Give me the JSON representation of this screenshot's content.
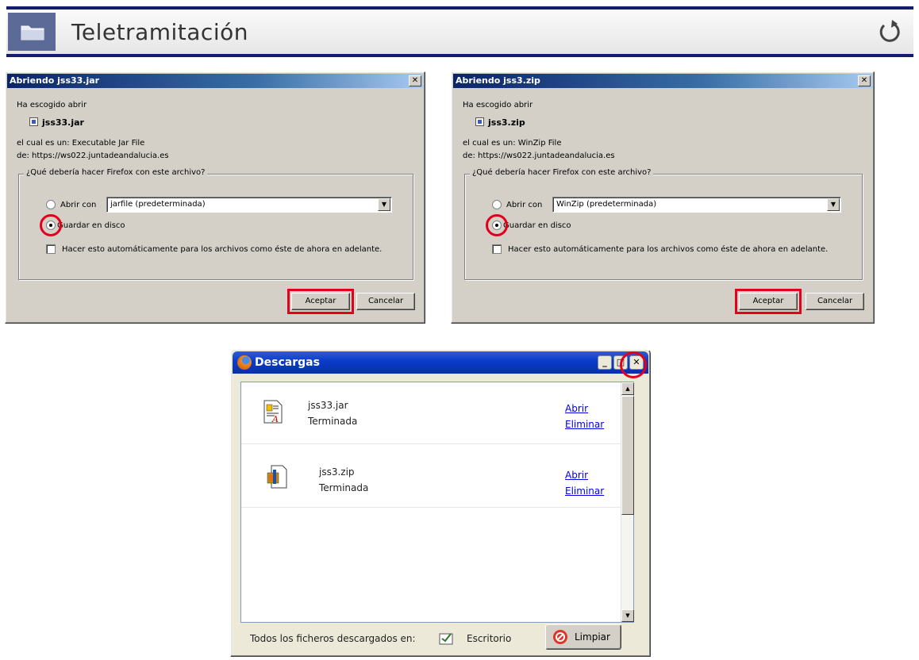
{
  "banner": {
    "title": "Teletramitación",
    "folder_icon": "folder-icon",
    "refresh_icon": "refresh-icon"
  },
  "dialog_jar": {
    "title": "Abriendo jss33.jar",
    "chosen_label": "Ha escogido abrir",
    "filename": "jss33.jar",
    "type_line": "el cual es un:  Executable Jar File",
    "from_line": "de:  https://ws022.juntadeandalucia.es",
    "group_label": "¿Qué debería hacer Firefox con este archivo?",
    "open_with_label": "Abrir con",
    "open_with_value": "jarfile (predeterminada)",
    "save_label": "Guardar en disco",
    "auto_label": "Hacer esto automáticamente para los archivos como éste de ahora en adelante.",
    "accept_label": "Aceptar",
    "cancel_label": "Cancelar",
    "close_glyph": "✕"
  },
  "dialog_zip": {
    "title": "Abriendo jss3.zip",
    "chosen_label": "Ha escogido abrir",
    "filename": "jss3.zip",
    "type_line": "el cual es un:  WinZip File",
    "from_line": "de:  https://ws022.juntadeandalucia.es",
    "group_label": "¿Qué debería hacer Firefox con este archivo?",
    "open_with_label": "Abrir con",
    "open_with_value": "WinZip (predeterminada)",
    "save_label": "Guardar en disco",
    "auto_label": "Hacer esto automáticamente para los archivos como éste de ahora en adelante.",
    "accept_label": "Aceptar",
    "cancel_label": "Cancelar",
    "close_glyph": "✕"
  },
  "downloads": {
    "title": "Descargas",
    "minimize_glyph": "_",
    "maximize_glyph": "□",
    "close_glyph": "✕",
    "items": [
      {
        "name": "jss33.jar",
        "status": "Terminada",
        "open": "Abrir",
        "remove": "Eliminar",
        "icon": "jar-file-icon"
      },
      {
        "name": "jss3.zip",
        "status": "Terminada",
        "open": "Abrir",
        "remove": "Eliminar",
        "icon": "zip-file-icon"
      }
    ],
    "footer_label": "Todos los ficheros descargados en:",
    "folder_name": "Escritorio",
    "clear_label": "Limpiar"
  },
  "colors": {
    "highlight": "#e3001b",
    "banner_border": "#131d6b",
    "titlebar_classic": "#0a246a",
    "titlebar_xp": "#0a3bc9"
  }
}
